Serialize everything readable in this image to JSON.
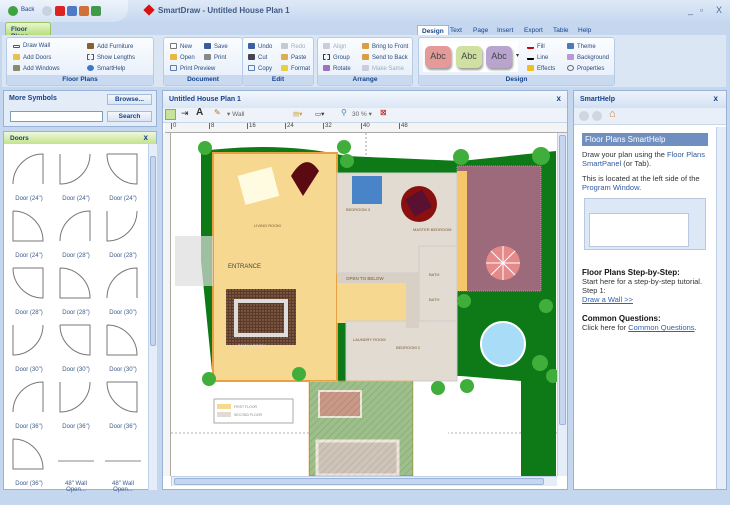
{
  "app": {
    "title": "SmartDraw - Untitled House Plan 1",
    "back_label": "Back"
  },
  "window_controls": {
    "minimize": "_",
    "restore": "▫",
    "close": "X"
  },
  "ribbon": {
    "left_tab": "Floor Plans",
    "tabs": [
      "Design",
      "Text",
      "Page",
      "Insert",
      "Export",
      "Table",
      "Help"
    ],
    "active_tab": "Design",
    "floor_plans": {
      "label": "Floor Plans",
      "items": [
        "Draw Wall",
        "Add Doors",
        "Add Windows",
        "Add Furniture",
        "Show Lengths",
        "SmartHelp"
      ]
    },
    "document": {
      "label": "Document",
      "items": [
        "New",
        "Save",
        "Open",
        "Print",
        "Print Preview"
      ]
    },
    "edit": {
      "label": "Edit",
      "items": [
        "Undo",
        "Redo",
        "Cut",
        "Paste",
        "Copy",
        "Format"
      ]
    },
    "arrange": {
      "label": "Arrange",
      "items": [
        "Align",
        "Group",
        "Rotate",
        "Bring to Front",
        "Send to Back",
        "Make Same"
      ]
    },
    "design": {
      "label": "Design",
      "styles": [
        "Abc",
        "Abc",
        "Abc"
      ],
      "style_colors": [
        "#e59a9a",
        "#cfe0a0",
        "#b9a3cf"
      ],
      "items": [
        "Fill",
        "Line",
        "Effects",
        "Theme",
        "Background",
        "Properties"
      ]
    }
  },
  "left": {
    "more_symbols": "More Symbols",
    "browse": "Browse...",
    "search_btn": "Search",
    "search_value": "",
    "library": "Doors",
    "close": "x",
    "symbols": [
      "Door (24\")",
      "Door (24\")",
      "Door (24\")",
      "Door (24\")",
      "Door (28\")",
      "Door (28\")",
      "Door (28\")",
      "Door (28\")",
      "Door (30\")",
      "Door (30\")",
      "Door (30\")",
      "Door (30\")",
      "Door (36\")",
      "Door (36\")",
      "Door (36\")",
      "Door (36\")",
      "48\" Wall Open...",
      "48\" Wall Open..."
    ]
  },
  "doc": {
    "title": "Untitled House Plan 1",
    "close": "x",
    "toolbar": {
      "wall_label": "Wall",
      "zoom": "30 %"
    },
    "ruler": [
      "0",
      "8",
      "16",
      "24",
      "32",
      "40",
      "48"
    ],
    "rooms": {
      "living": "LIVING ROOM",
      "entrance": "ENTRANCE",
      "open": "OPEN TO BELOW",
      "family": "FAMILY ROOM",
      "bed3": "BEDROOM 3",
      "master": "MASTER BEDROOM",
      "bath1": "BATH",
      "bath2": "BATH",
      "laundry": "LAUNDRY ROOM",
      "bed2": "BEDROOM 2"
    },
    "legend": [
      "FIRST FLOOR",
      "SECOND FLOOR"
    ]
  },
  "help": {
    "title": "SmartHelp",
    "close": "x",
    "heading": "Floor Plans SmartHelp",
    "p1a": "Draw your plan using the ",
    "p1b": "Floor Plans SmartPanel",
    "p1c": " (or Tab).",
    "p2a": "This is located at the left side of the ",
    "p2b": "Program Window",
    "p2c": ".",
    "h2": "Floor Plans Step-by-Step:",
    "p3": "Start here for a step-by-step tutorial. Step 1:",
    "link1": "Draw a Wall >>",
    "h3": "Common Questions:",
    "p4": "Click here for ",
    "link2": "Common Questions",
    "p4end": "."
  }
}
